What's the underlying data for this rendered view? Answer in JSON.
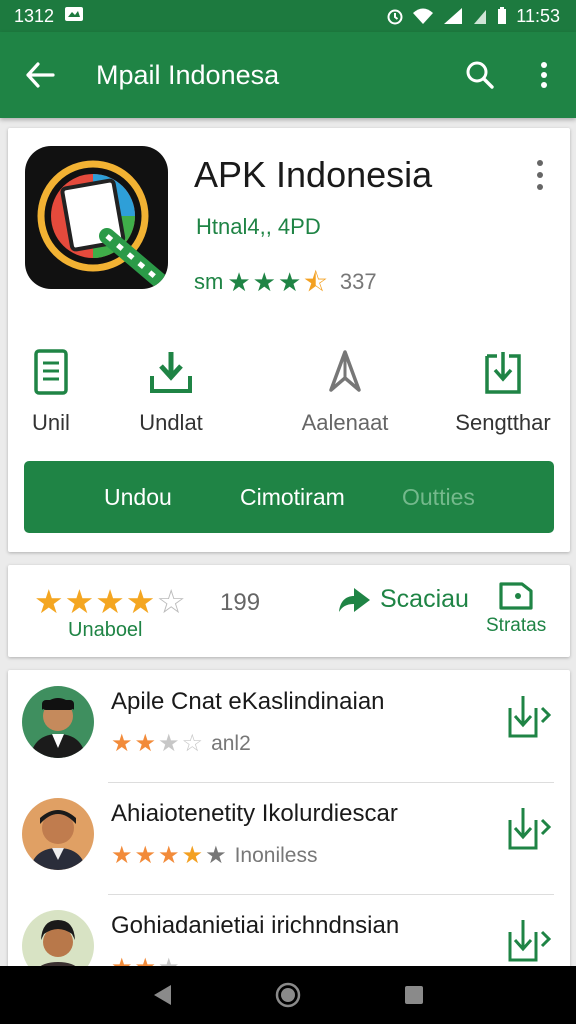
{
  "status_bar": {
    "left_time": "1312",
    "right_time": "11:53"
  },
  "app_bar": {
    "title": "Mpail Indonesa"
  },
  "app": {
    "name": "APK Indonesia",
    "developer": "Htnal4,, 4PD",
    "rating_prefix": "sm",
    "rating_count": "337"
  },
  "actions": [
    {
      "label": "Unil",
      "icon": "document-icon"
    },
    {
      "label": "Undlat",
      "icon": "download-icon"
    },
    {
      "label": "Aalenaat",
      "icon": "share-arrow-icon"
    },
    {
      "label": "Sengtthar",
      "icon": "download-box-icon"
    }
  ],
  "tabs": [
    {
      "label": "Undou",
      "active": true
    },
    {
      "label": "Cimotiram",
      "active": true
    },
    {
      "label": "Outties",
      "active": false
    }
  ],
  "rating_card": {
    "stars": 4,
    "count": "199",
    "label": "Unaboel",
    "share_label": "Scaciau",
    "stats_label": "Stratas"
  },
  "list": [
    {
      "name": "Apile Cnat eKaslindinaian",
      "stars": 2,
      "meta": "anl2"
    },
    {
      "name": "Ahiaiotenetity Ikolurdiescar",
      "stars": 3.5,
      "meta": "Inoniless"
    },
    {
      "name": "Gohiadanietiai irichndnsian",
      "stars": 2,
      "meta": ""
    }
  ],
  "colors": {
    "primary": "#1f8445",
    "status_bar": "#1d7a3f",
    "star_gold": "#f4a621",
    "star_orange": "#f28b3a"
  }
}
